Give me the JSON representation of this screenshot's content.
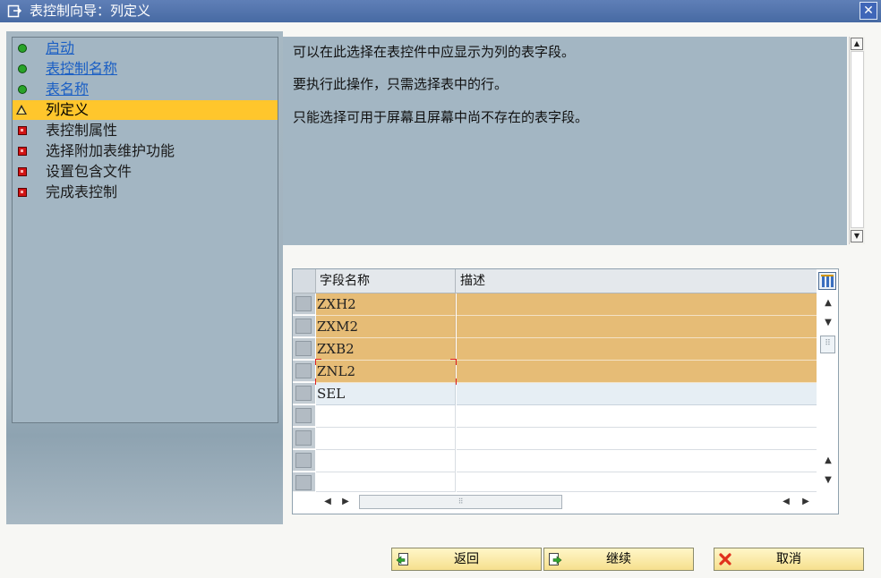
{
  "window": {
    "title": "表控制向导：列定义"
  },
  "steps": [
    {
      "label": "启动",
      "status": "done"
    },
    {
      "label": "表控制名称",
      "status": "done"
    },
    {
      "label": "表名称",
      "status": "done"
    },
    {
      "label": "列定义",
      "status": "current"
    },
    {
      "label": "表控制属性",
      "status": "pending"
    },
    {
      "label": "选择附加表维护功能",
      "status": "pending"
    },
    {
      "label": "设置包含文件",
      "status": "pending"
    },
    {
      "label": "完成表控制",
      "status": "pending"
    }
  ],
  "info": {
    "lines": [
      "可以在此选择在表控件中应显示为列的表字段。",
      "要执行此操作，只需选择表中的行。",
      "只能选择可用于屏幕且屏幕中尚不存在的表字段。"
    ]
  },
  "table": {
    "columns": [
      "字段名称",
      "描述"
    ],
    "rows": [
      {
        "field": "ZXH2",
        "desc": "",
        "selected": true
      },
      {
        "field": "ZXM2",
        "desc": "",
        "selected": true
      },
      {
        "field": "ZXB2",
        "desc": "",
        "selected": true
      },
      {
        "field": "ZNL2",
        "desc": "",
        "selected": true
      },
      {
        "field": "SEL",
        "desc": "",
        "selected": false
      },
      {
        "field": "",
        "desc": "",
        "selected": false
      },
      {
        "field": "",
        "desc": "",
        "selected": false
      },
      {
        "field": "",
        "desc": "",
        "selected": false
      },
      {
        "field": "",
        "desc": "",
        "selected": false
      }
    ]
  },
  "buttons": {
    "back": "返回",
    "continue": "继续",
    "cancel": "取消"
  },
  "colors": {
    "accent": "#ffc62c",
    "selected_row": "#e6bc76",
    "panel": "#a3b6c3"
  }
}
